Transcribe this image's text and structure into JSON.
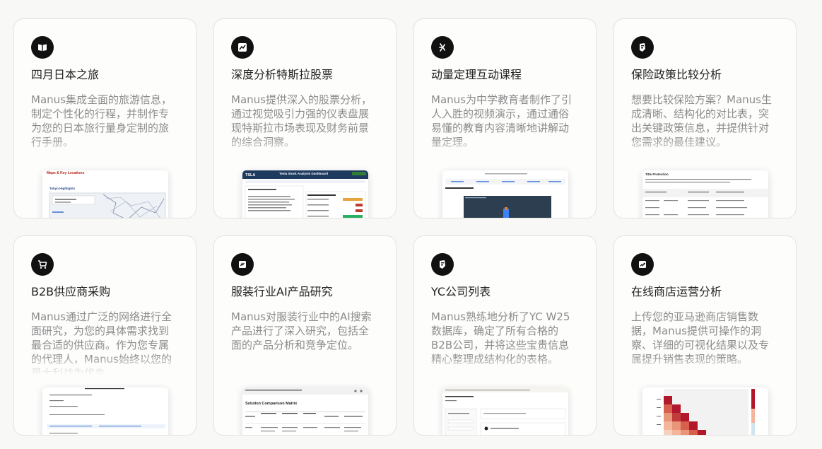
{
  "cards": [
    {
      "icon": "book-open-icon",
      "title": "四月日本之旅",
      "description": "Manus集成全面的旅游信息，制定个性化的行程，并制作专为您的日本旅行量身定制的旅行手册。",
      "thumbnail": {
        "heading": "Maps & Key Locations",
        "subheading": "Tokyo Highlights"
      }
    },
    {
      "icon": "chart-dashboard-icon",
      "title": "深度分析特斯拉股票",
      "description": "Manus提供深入的股票分析，通过视觉吸引力强的仪表盘展现特斯拉市场表现及财务前景的综合洞察。",
      "thumbnail": {
        "ticker": "TSLA",
        "heading": "Tesla Stock Analysis Dashboard"
      }
    },
    {
      "icon": "atom-icon",
      "title": "动量定理互动课程",
      "description": "Manus为中学教育者制作了引人入胜的视频演示，通过通俗易懂的教育内容清晰地讲解动量定理。",
      "thumbnail": {
        "heading": ""
      }
    },
    {
      "icon": "shield-document-icon",
      "title": "保险政策比较分析",
      "description": "想要比较保险方案？Manus生成清晰、结构化的对比表，突出关键政策信息，并提供针对您需求的最佳建议。",
      "thumbnail": {
        "heading": "Title Protection"
      }
    },
    {
      "icon": "shopping-cart-icon",
      "title": "B2B供应商采购",
      "description": "Manus通过广泛的网络进行全面研究，为您的具体需求找到最合适的供应商。作为您专属的代理人，Manus始终以您的最大利益为优先。",
      "thumbnail": {
        "heading": ""
      }
    },
    {
      "icon": "clothing-tag-icon",
      "title": "服装行业AI产品研究",
      "description": "Manus对服装行业中的AI搜索产品进行了深入研究，包括全面的产品分析和竞争定位。",
      "thumbnail": {
        "heading": "Solution Comparison Matrix"
      }
    },
    {
      "icon": "shield-document-icon",
      "title": "YC公司列表",
      "description": "Manus熟练地分析了YC W25数据库，确定了所有合格的B2B公司，并将这些宝贵信息精心整理成结构化的表格。",
      "thumbnail": {
        "heading": ""
      }
    },
    {
      "icon": "trending-chart-icon",
      "title": "在线商店运营分析",
      "description": "上传您的亚马逊商店销售数据，Manus提供可操作的洞察、详细的可视化结果以及专属提升销售表现的策略。",
      "thumbnail": {
        "heading": ""
      }
    }
  ]
}
